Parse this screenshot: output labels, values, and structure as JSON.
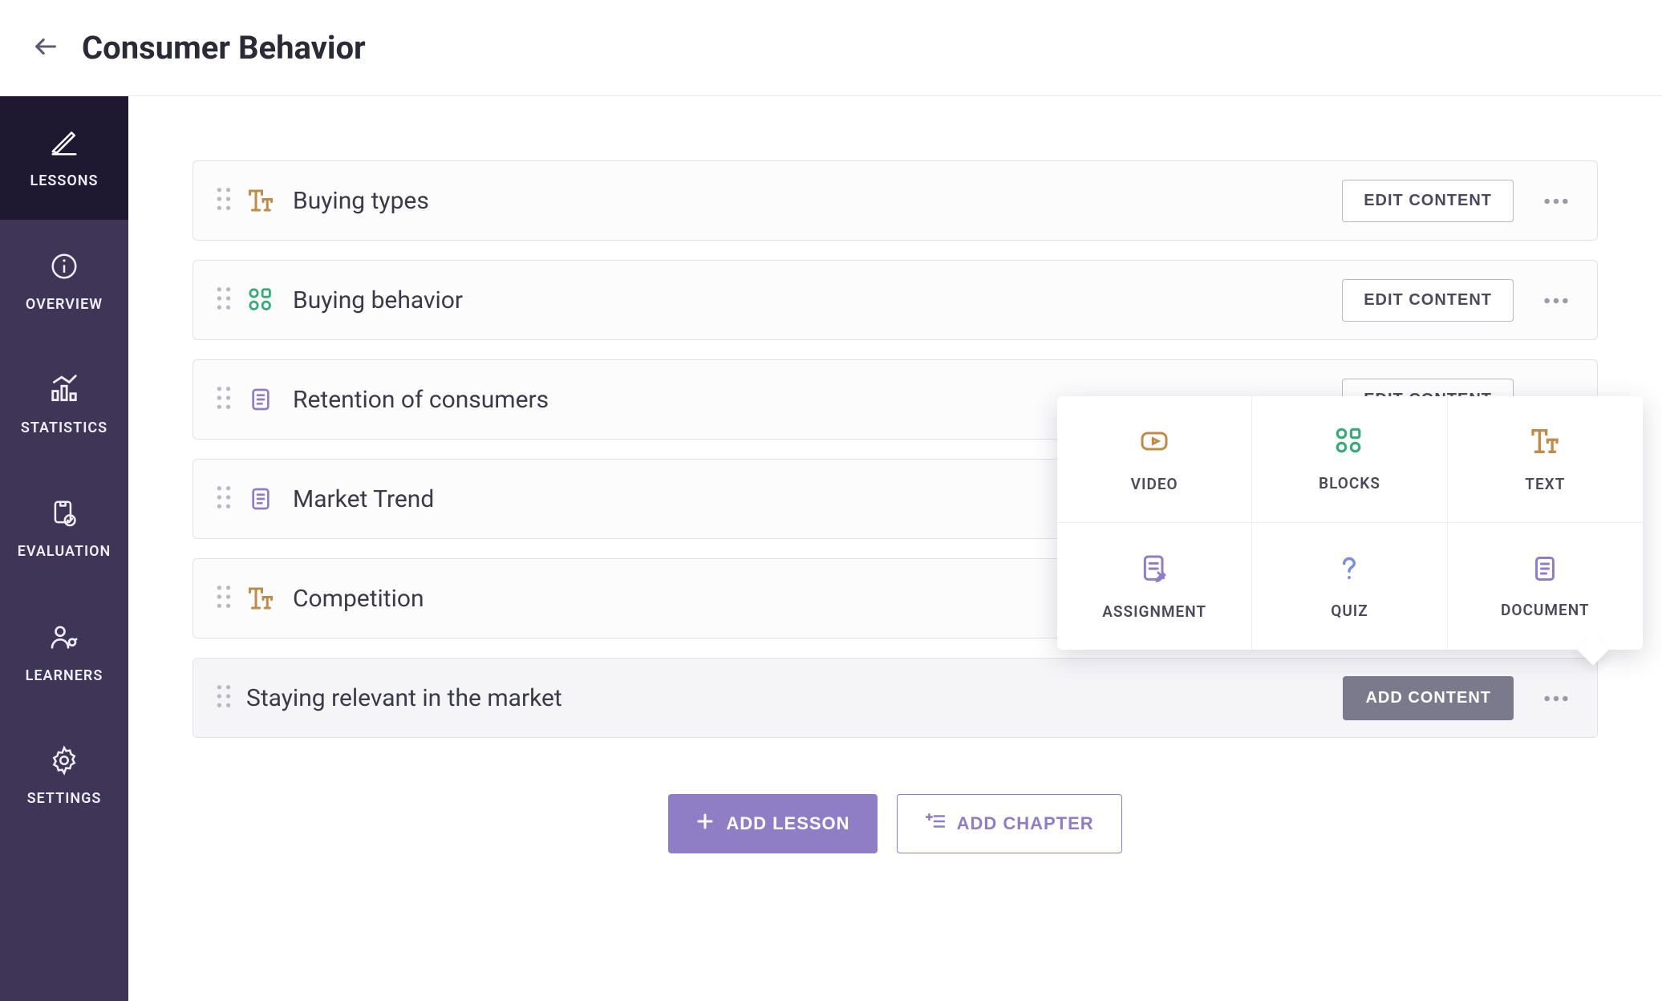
{
  "header": {
    "title": "Consumer Behavior"
  },
  "sidebar": {
    "items": [
      {
        "label": "LESSONS",
        "icon": "pencil",
        "active": true
      },
      {
        "label": "OVERVIEW",
        "icon": "info",
        "active": false
      },
      {
        "label": "STATISTICS",
        "icon": "chart",
        "active": false
      },
      {
        "label": "EVALUATION",
        "icon": "clipboard",
        "active": false
      },
      {
        "label": "LEARNERS",
        "icon": "people",
        "active": false
      },
      {
        "label": "SETTINGS",
        "icon": "gear",
        "active": false
      }
    ]
  },
  "lessons": [
    {
      "title": "Buying types",
      "type": "text",
      "action": "edit"
    },
    {
      "title": "Buying behavior",
      "type": "blocks",
      "action": "edit"
    },
    {
      "title": "Retention of consumers",
      "type": "document",
      "action": "edit"
    },
    {
      "title": "Market Trend",
      "type": "document",
      "action": "edit"
    },
    {
      "title": "Competition",
      "type": "text",
      "action": "edit"
    },
    {
      "title": "Staying relevant in the market",
      "type": "chapter",
      "action": "add"
    }
  ],
  "buttons": {
    "edit": "EDIT CONTENT",
    "add": "ADD CONTENT",
    "add_lesson": "ADD LESSON",
    "add_chapter": "ADD CHAPTER"
  },
  "popover": {
    "items": [
      {
        "label": "VIDEO",
        "icon": "video",
        "color": "#c08a4a"
      },
      {
        "label": "BLOCKS",
        "icon": "blocks",
        "color": "#3aa97b"
      },
      {
        "label": "TEXT",
        "icon": "text",
        "color": "#c08a4a"
      },
      {
        "label": "ASSIGNMENT",
        "icon": "assignment",
        "color": "#8f7ec5"
      },
      {
        "label": "QUIZ",
        "icon": "quiz",
        "color": "#7a8edb"
      },
      {
        "label": "DOCUMENT",
        "icon": "document",
        "color": "#8f7ec5"
      }
    ]
  }
}
